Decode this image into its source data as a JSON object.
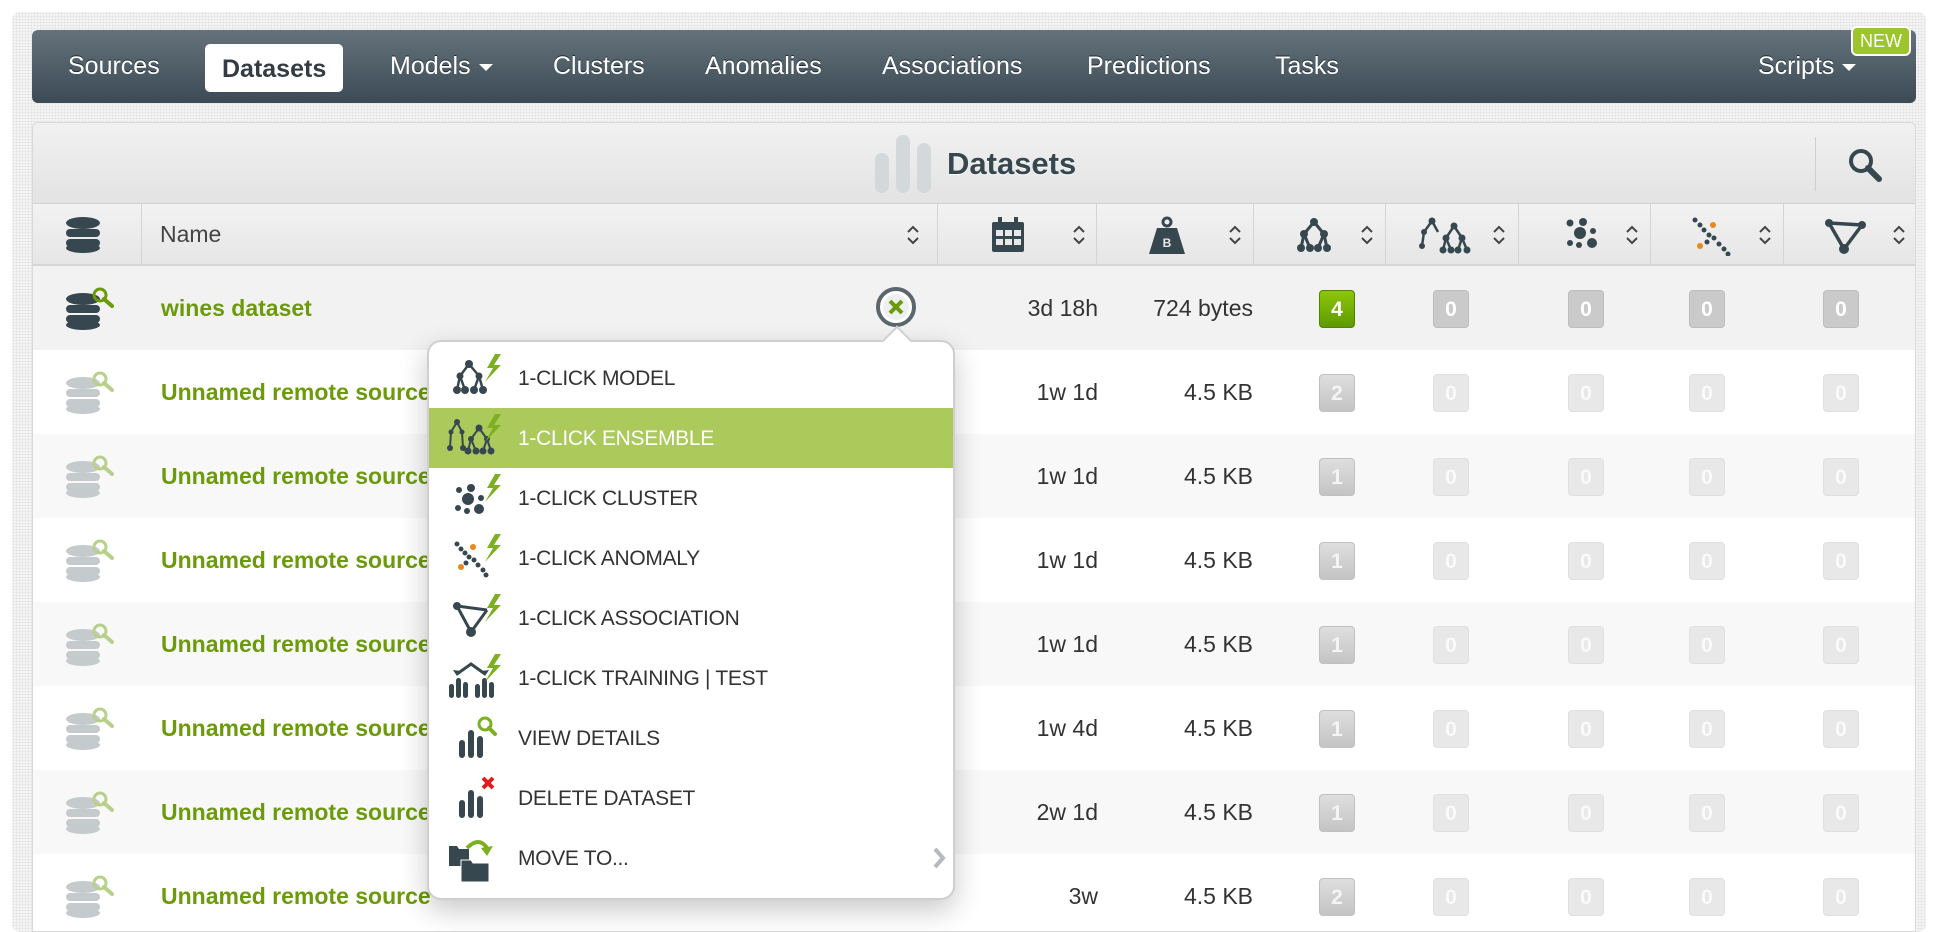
{
  "nav": {
    "items": [
      {
        "label": "Sources",
        "active": false
      },
      {
        "label": "Datasets",
        "active": true
      },
      {
        "label": "Models",
        "active": false,
        "dropdown": true
      },
      {
        "label": "Clusters",
        "active": false
      },
      {
        "label": "Anomalies",
        "active": false
      },
      {
        "label": "Associations",
        "active": false
      },
      {
        "label": "Predictions",
        "active": false
      },
      {
        "label": "Tasks",
        "active": false
      }
    ],
    "scripts_label": "Scripts",
    "new_badge": "NEW"
  },
  "panel": {
    "title": "Datasets",
    "search_icon": "search-icon"
  },
  "columns": [
    {
      "key": "type",
      "icon": "database-icon"
    },
    {
      "key": "name",
      "label": "Name",
      "sortable": true
    },
    {
      "key": "age",
      "icon": "calendar-icon",
      "sortable": true
    },
    {
      "key": "size",
      "icon": "weight-bytes-icon",
      "sortable": true
    },
    {
      "key": "models",
      "icon": "model-tree-icon",
      "sortable": true
    },
    {
      "key": "ensembles",
      "icon": "ensemble-icon",
      "sortable": true
    },
    {
      "key": "clusters",
      "icon": "cluster-icon",
      "sortable": true
    },
    {
      "key": "anomalies",
      "icon": "anomaly-icon",
      "sortable": true
    },
    {
      "key": "associations",
      "icon": "association-icon",
      "sortable": true
    }
  ],
  "rows": [
    {
      "name": "wines dataset",
      "age": "3d 18h",
      "size": "724 bytes",
      "models": "4",
      "ensembles": "0",
      "clusters": "0",
      "anomalies": "0",
      "associations": "0",
      "selected": true
    },
    {
      "name": "Unnamed remote source",
      "age": "1w 1d",
      "size": "4.5 KB",
      "models": "2",
      "ensembles": "0",
      "clusters": "0",
      "anomalies": "0",
      "associations": "0"
    },
    {
      "name": "Unnamed remote source",
      "age": "1w 1d",
      "size": "4.5 KB",
      "models": "1",
      "ensembles": "0",
      "clusters": "0",
      "anomalies": "0",
      "associations": "0"
    },
    {
      "name": "Unnamed remote source",
      "age": "1w 1d",
      "size": "4.5 KB",
      "models": "1",
      "ensembles": "0",
      "clusters": "0",
      "anomalies": "0",
      "associations": "0"
    },
    {
      "name": "Unnamed remote source",
      "age": "1w 1d",
      "size": "4.5 KB",
      "models": "1",
      "ensembles": "0",
      "clusters": "0",
      "anomalies": "0",
      "associations": "0"
    },
    {
      "name": "Unnamed remote source",
      "age": "1w 4d",
      "size": "4.5 KB",
      "models": "1",
      "ensembles": "0",
      "clusters": "0",
      "anomalies": "0",
      "associations": "0"
    },
    {
      "name": "Unnamed remote source",
      "age": "2w 1d",
      "size": "4.5 KB",
      "models": "1",
      "ensembles": "0",
      "clusters": "0",
      "anomalies": "0",
      "associations": "0"
    },
    {
      "name": "Unnamed remote source",
      "age": "3w",
      "size": "4.5 KB",
      "models": "2",
      "ensembles": "0",
      "clusters": "0",
      "anomalies": "0",
      "associations": "0"
    }
  ],
  "context_menu": {
    "items": [
      {
        "label": "1-CLICK MODEL",
        "icon": "one-click-model-icon"
      },
      {
        "label": "1-CLICK ENSEMBLE",
        "icon": "one-click-ensemble-icon",
        "highlighted": true
      },
      {
        "label": "1-CLICK CLUSTER",
        "icon": "one-click-cluster-icon"
      },
      {
        "label": "1-CLICK ANOMALY",
        "icon": "one-click-anomaly-icon"
      },
      {
        "label": "1-CLICK ASSOCIATION",
        "icon": "one-click-association-icon"
      },
      {
        "label": "1-CLICK TRAINING | TEST",
        "icon": "one-click-training-test-icon"
      },
      {
        "label": "VIEW DETAILS",
        "icon": "view-details-icon"
      },
      {
        "label": "DELETE DATASET",
        "icon": "delete-dataset-icon"
      },
      {
        "label": "MOVE TO...",
        "icon": "move-to-icon",
        "submenu": true
      }
    ]
  },
  "colors": {
    "accent_green": "#6b9a0a",
    "menu_highlight": "#acc95c",
    "nav_dark": "#3b4a55",
    "badge_green": "#9bc52a"
  }
}
